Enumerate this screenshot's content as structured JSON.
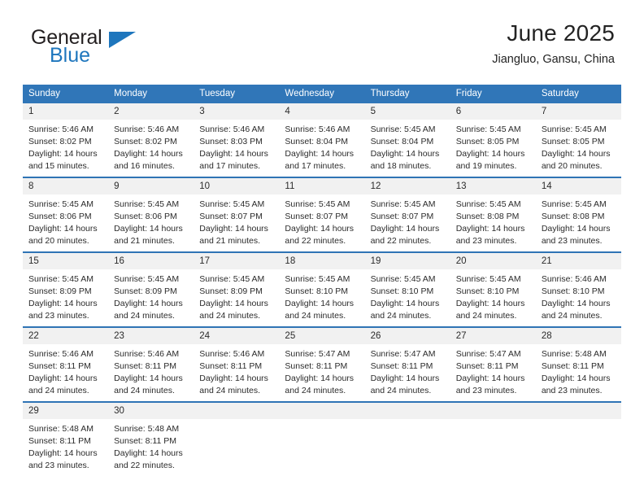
{
  "brand": {
    "name_top": "General",
    "name_bottom": "Blue",
    "accent_color": "#1e76bd"
  },
  "header": {
    "title": "June 2025",
    "subtitle": "Jiangluo, Gansu, China"
  },
  "calendar": {
    "header_color": "#3076b8",
    "daynum_band_color": "#f1f1f1",
    "weekday_names": [
      "Sunday",
      "Monday",
      "Tuesday",
      "Wednesday",
      "Thursday",
      "Friday",
      "Saturday"
    ],
    "weeks": [
      {
        "numbers": [
          "1",
          "2",
          "3",
          "4",
          "5",
          "6",
          "7"
        ],
        "days": [
          {
            "sunrise": "Sunrise: 5:46 AM",
            "sunset": "Sunset: 8:02 PM",
            "daylight1": "Daylight: 14 hours",
            "daylight2": "and 15 minutes."
          },
          {
            "sunrise": "Sunrise: 5:46 AM",
            "sunset": "Sunset: 8:02 PM",
            "daylight1": "Daylight: 14 hours",
            "daylight2": "and 16 minutes."
          },
          {
            "sunrise": "Sunrise: 5:46 AM",
            "sunset": "Sunset: 8:03 PM",
            "daylight1": "Daylight: 14 hours",
            "daylight2": "and 17 minutes."
          },
          {
            "sunrise": "Sunrise: 5:46 AM",
            "sunset": "Sunset: 8:04 PM",
            "daylight1": "Daylight: 14 hours",
            "daylight2": "and 17 minutes."
          },
          {
            "sunrise": "Sunrise: 5:45 AM",
            "sunset": "Sunset: 8:04 PM",
            "daylight1": "Daylight: 14 hours",
            "daylight2": "and 18 minutes."
          },
          {
            "sunrise": "Sunrise: 5:45 AM",
            "sunset": "Sunset: 8:05 PM",
            "daylight1": "Daylight: 14 hours",
            "daylight2": "and 19 minutes."
          },
          {
            "sunrise": "Sunrise: 5:45 AM",
            "sunset": "Sunset: 8:05 PM",
            "daylight1": "Daylight: 14 hours",
            "daylight2": "and 20 minutes."
          }
        ]
      },
      {
        "numbers": [
          "8",
          "9",
          "10",
          "11",
          "12",
          "13",
          "14"
        ],
        "days": [
          {
            "sunrise": "Sunrise: 5:45 AM",
            "sunset": "Sunset: 8:06 PM",
            "daylight1": "Daylight: 14 hours",
            "daylight2": "and 20 minutes."
          },
          {
            "sunrise": "Sunrise: 5:45 AM",
            "sunset": "Sunset: 8:06 PM",
            "daylight1": "Daylight: 14 hours",
            "daylight2": "and 21 minutes."
          },
          {
            "sunrise": "Sunrise: 5:45 AM",
            "sunset": "Sunset: 8:07 PM",
            "daylight1": "Daylight: 14 hours",
            "daylight2": "and 21 minutes."
          },
          {
            "sunrise": "Sunrise: 5:45 AM",
            "sunset": "Sunset: 8:07 PM",
            "daylight1": "Daylight: 14 hours",
            "daylight2": "and 22 minutes."
          },
          {
            "sunrise": "Sunrise: 5:45 AM",
            "sunset": "Sunset: 8:07 PM",
            "daylight1": "Daylight: 14 hours",
            "daylight2": "and 22 minutes."
          },
          {
            "sunrise": "Sunrise: 5:45 AM",
            "sunset": "Sunset: 8:08 PM",
            "daylight1": "Daylight: 14 hours",
            "daylight2": "and 23 minutes."
          },
          {
            "sunrise": "Sunrise: 5:45 AM",
            "sunset": "Sunset: 8:08 PM",
            "daylight1": "Daylight: 14 hours",
            "daylight2": "and 23 minutes."
          }
        ]
      },
      {
        "numbers": [
          "15",
          "16",
          "17",
          "18",
          "19",
          "20",
          "21"
        ],
        "days": [
          {
            "sunrise": "Sunrise: 5:45 AM",
            "sunset": "Sunset: 8:09 PM",
            "daylight1": "Daylight: 14 hours",
            "daylight2": "and 23 minutes."
          },
          {
            "sunrise": "Sunrise: 5:45 AM",
            "sunset": "Sunset: 8:09 PM",
            "daylight1": "Daylight: 14 hours",
            "daylight2": "and 24 minutes."
          },
          {
            "sunrise": "Sunrise: 5:45 AM",
            "sunset": "Sunset: 8:09 PM",
            "daylight1": "Daylight: 14 hours",
            "daylight2": "and 24 minutes."
          },
          {
            "sunrise": "Sunrise: 5:45 AM",
            "sunset": "Sunset: 8:10 PM",
            "daylight1": "Daylight: 14 hours",
            "daylight2": "and 24 minutes."
          },
          {
            "sunrise": "Sunrise: 5:45 AM",
            "sunset": "Sunset: 8:10 PM",
            "daylight1": "Daylight: 14 hours",
            "daylight2": "and 24 minutes."
          },
          {
            "sunrise": "Sunrise: 5:45 AM",
            "sunset": "Sunset: 8:10 PM",
            "daylight1": "Daylight: 14 hours",
            "daylight2": "and 24 minutes."
          },
          {
            "sunrise": "Sunrise: 5:46 AM",
            "sunset": "Sunset: 8:10 PM",
            "daylight1": "Daylight: 14 hours",
            "daylight2": "and 24 minutes."
          }
        ]
      },
      {
        "numbers": [
          "22",
          "23",
          "24",
          "25",
          "26",
          "27",
          "28"
        ],
        "days": [
          {
            "sunrise": "Sunrise: 5:46 AM",
            "sunset": "Sunset: 8:11 PM",
            "daylight1": "Daylight: 14 hours",
            "daylight2": "and 24 minutes."
          },
          {
            "sunrise": "Sunrise: 5:46 AM",
            "sunset": "Sunset: 8:11 PM",
            "daylight1": "Daylight: 14 hours",
            "daylight2": "and 24 minutes."
          },
          {
            "sunrise": "Sunrise: 5:46 AM",
            "sunset": "Sunset: 8:11 PM",
            "daylight1": "Daylight: 14 hours",
            "daylight2": "and 24 minutes."
          },
          {
            "sunrise": "Sunrise: 5:47 AM",
            "sunset": "Sunset: 8:11 PM",
            "daylight1": "Daylight: 14 hours",
            "daylight2": "and 24 minutes."
          },
          {
            "sunrise": "Sunrise: 5:47 AM",
            "sunset": "Sunset: 8:11 PM",
            "daylight1": "Daylight: 14 hours",
            "daylight2": "and 24 minutes."
          },
          {
            "sunrise": "Sunrise: 5:47 AM",
            "sunset": "Sunset: 8:11 PM",
            "daylight1": "Daylight: 14 hours",
            "daylight2": "and 23 minutes."
          },
          {
            "sunrise": "Sunrise: 5:48 AM",
            "sunset": "Sunset: 8:11 PM",
            "daylight1": "Daylight: 14 hours",
            "daylight2": "and 23 minutes."
          }
        ]
      },
      {
        "numbers": [
          "29",
          "30",
          "",
          "",
          "",
          "",
          ""
        ],
        "days": [
          {
            "sunrise": "Sunrise: 5:48 AM",
            "sunset": "Sunset: 8:11 PM",
            "daylight1": "Daylight: 14 hours",
            "daylight2": "and 23 minutes."
          },
          {
            "sunrise": "Sunrise: 5:48 AM",
            "sunset": "Sunset: 8:11 PM",
            "daylight1": "Daylight: 14 hours",
            "daylight2": "and 22 minutes."
          },
          {
            "sunrise": "",
            "sunset": "",
            "daylight1": "",
            "daylight2": ""
          },
          {
            "sunrise": "",
            "sunset": "",
            "daylight1": "",
            "daylight2": ""
          },
          {
            "sunrise": "",
            "sunset": "",
            "daylight1": "",
            "daylight2": ""
          },
          {
            "sunrise": "",
            "sunset": "",
            "daylight1": "",
            "daylight2": ""
          },
          {
            "sunrise": "",
            "sunset": "",
            "daylight1": "",
            "daylight2": ""
          }
        ]
      }
    ]
  }
}
